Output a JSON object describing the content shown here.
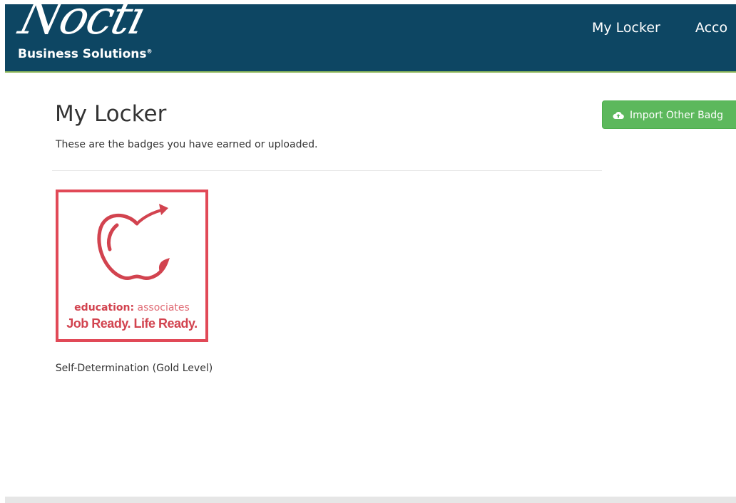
{
  "brand": {
    "logo_script": "Nocti",
    "logo_sub": "Business Solutions",
    "logo_mark": "®"
  },
  "nav": {
    "items": [
      {
        "label": "My Locker"
      },
      {
        "label": "Acco"
      }
    ]
  },
  "main": {
    "title": "My Locker",
    "subtitle": "These are the badges you have earned or uploaded.",
    "import_button": {
      "icon": "cloud-upload-icon",
      "label": "Import Other Badg"
    }
  },
  "badges": [
    {
      "image_text_line1_bold": "education:",
      "image_text_line1_light": "associates",
      "image_text_line2": "Job Ready. Life Ready.",
      "caption": "Self-Determination (Gold Level)"
    }
  ],
  "colors": {
    "navbar": "#0d4663",
    "navbar_accent": "#8fb85a",
    "import_button": "#5cb85c",
    "badge_red": "#e14957"
  }
}
